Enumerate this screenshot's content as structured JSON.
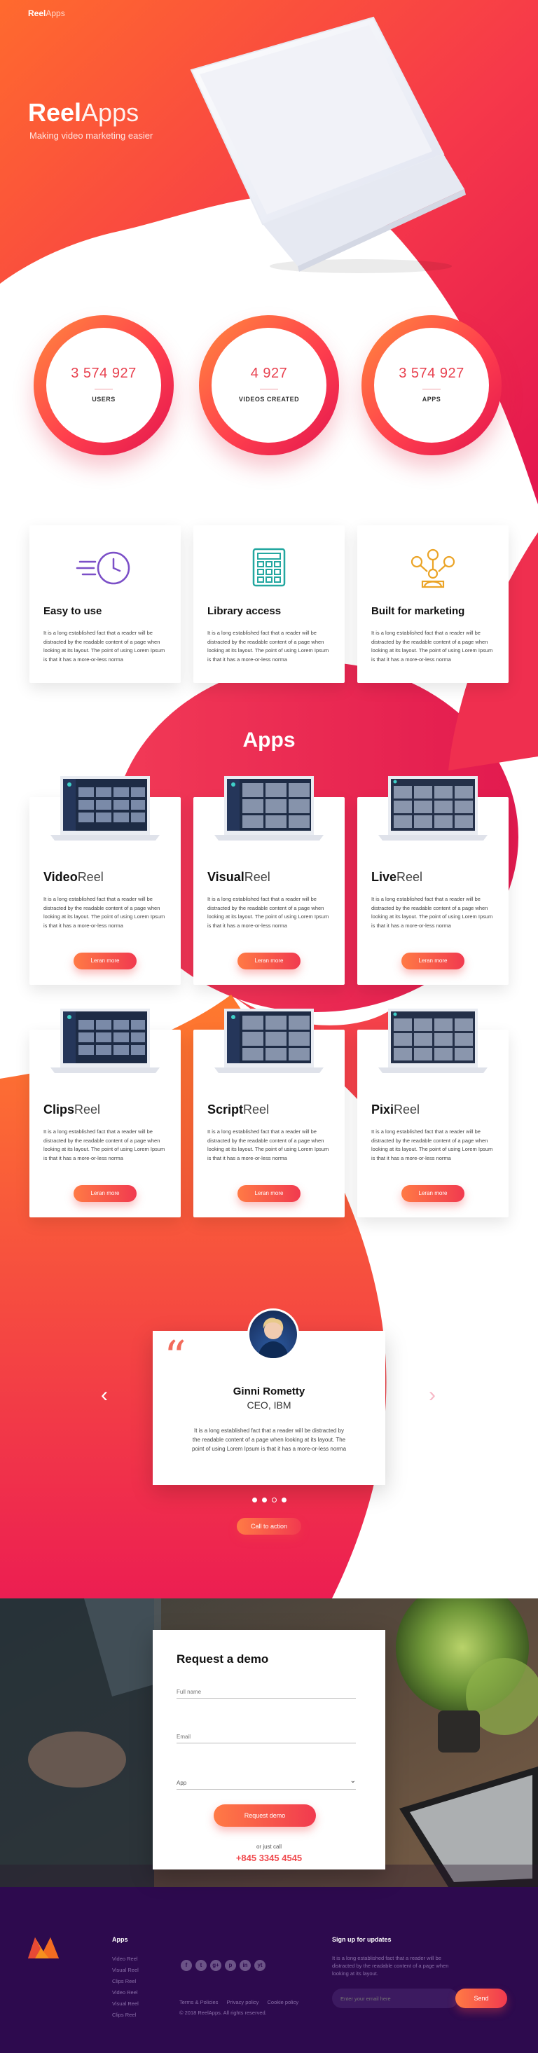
{
  "header": {
    "logo_bold": "Reel",
    "logo_light": "Apps"
  },
  "hero": {
    "title_bold": "Reel",
    "title_light": "Apps",
    "subtitle": "Making video marketing easier"
  },
  "stats": [
    {
      "value": "3 574 927",
      "label": "USERS"
    },
    {
      "value": "4 927",
      "label": "VIDEOS CREATED"
    },
    {
      "value": "3 574 927",
      "label": "APPS"
    }
  ],
  "features": [
    {
      "icon": "clock-speed-icon",
      "title": "Easy to use",
      "text": "It is a long established fact that a reader will be distracted by the readable content of a page when looking at its layout. The point of using Lorem Ipsum is that it has a more-or-less norma"
    },
    {
      "icon": "grid-calculator-icon",
      "title": "Library access",
      "text": "It is a long established fact that a reader will be distracted by the readable content of a page when looking at its layout. The point of using Lorem Ipsum is that it has a more-or-less norma"
    },
    {
      "icon": "marketing-network-icon",
      "title": "Built for marketing",
      "text": "It is a long established fact that a reader will be distracted by the readable content of a page when looking at its layout. The point of using Lorem Ipsum is that it has a more-or-less norma"
    }
  ],
  "apps_heading": "Apps",
  "apps": [
    {
      "name_bold": "Video",
      "name_light": "Reel",
      "text": "It is a long established fact that a reader will be distracted by the readable content of a page when looking at its layout. The point of using Lorem Ipsum is that it has a more-or-less norma",
      "button": "Leran more"
    },
    {
      "name_bold": "Visual",
      "name_light": "Reel",
      "text": "It is a long established fact that a reader will be distracted by the readable content of a page when looking at its layout. The point of using Lorem Ipsum is that it has a more-or-less norma",
      "button": "Leran more"
    },
    {
      "name_bold": "Live",
      "name_light": "Reel",
      "text": "It is a long established fact that a reader will be distracted by the readable content of a page when looking at its layout. The point of using Lorem Ipsum is that it has a more-or-less norma",
      "button": "Leran more"
    },
    {
      "name_bold": "Clips",
      "name_light": "Reel",
      "text": "It is a long established fact that a reader will be distracted by the readable content of a page when looking at its layout. The point of using Lorem Ipsum is that it has a more-or-less norma",
      "button": "Leran more"
    },
    {
      "name_bold": "Script",
      "name_light": "Reel",
      "text": "It is a long established fact that a reader will be distracted by the readable content of a page when looking at its layout. The point of using Lorem Ipsum is that it has a more-or-less norma",
      "button": "Leran more"
    },
    {
      "name_bold": "Pixi",
      "name_light": "Reel",
      "text": "It is a long established fact that a reader will be distracted by the readable content of a page when looking at its layout. The point of using Lorem Ipsum is that it has a more-or-less norma",
      "button": "Leran more"
    }
  ],
  "testimonial": {
    "name": "Ginni Rometty",
    "role": "CEO, IBM",
    "text": "It is a long established fact that a reader will be distracted by the readable content of a page when looking at its layout. The point of using Lorem Ipsum is that it has a more-or-less norma",
    "dots_count": 4,
    "active_dot": 3
  },
  "cta": {
    "label": "Call to action"
  },
  "demo": {
    "title": "Request a demo",
    "full_name_placeholder": "Full name",
    "email_placeholder": "Email",
    "app_select": "App",
    "button": "Request demo",
    "or_call": "or just call",
    "phone": "+845 3345 4545"
  },
  "footer": {
    "apps_title": "Apps",
    "app_links": [
      "Video Reel",
      "Visual Reel",
      "Clips Reel",
      "Video Reel",
      "Visual Reel",
      "Clips Reel"
    ],
    "social": [
      "f",
      "t",
      "g+",
      "p",
      "in",
      "yt"
    ],
    "legal_links": [
      "Terms & Policies",
      "Privacy policy",
      "Cookie policy"
    ],
    "copyright": "© 2018 ReelApps. All rights reserved.",
    "signup_title": "Sign up for updates",
    "signup_text": "It is a long established fact that a reader will be distracted by the readable content of a page when looking at its layout.",
    "email_placeholder": "Enter your email here",
    "send": "Send"
  },
  "colors": {
    "accent": "#f13a4f",
    "orange": "#ff7a45",
    "footer": "#2d0a4e"
  }
}
